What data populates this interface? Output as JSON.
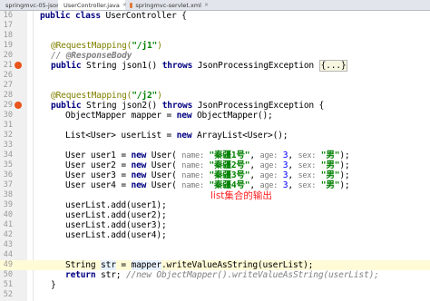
{
  "tabs": [
    {
      "label": "springmvc-05-json",
      "active": false
    },
    {
      "label": "UserController.java",
      "active": true
    },
    {
      "label": "springmvc-servlet.xml",
      "active": false
    }
  ],
  "lines": [
    {
      "n": "16",
      "code": "public class UserController {"
    },
    {
      "n": "17",
      "code": ""
    },
    {
      "n": "18",
      "code": ""
    },
    {
      "n": "19",
      "code": "@RequestMapping(\"/j1\")"
    },
    {
      "n": "20",
      "code": "// @ResponseBody"
    },
    {
      "n": "21",
      "code": "public String json1() throws JsonProcessingException {...}"
    },
    {
      "n": "26",
      "code": ""
    },
    {
      "n": "27",
      "code": ""
    },
    {
      "n": "28",
      "code": "@RequestMapping(\"/j2\")"
    },
    {
      "n": "29",
      "code": "public String json2() throws JsonProcessingException {"
    },
    {
      "n": "30",
      "code": "ObjectMapper mapper = new ObjectMapper();"
    },
    {
      "n": "31",
      "code": ""
    },
    {
      "n": "32",
      "code": "List<User> userList = new ArrayList<User>();"
    },
    {
      "n": "33",
      "code": ""
    },
    {
      "n": "34",
      "code": "User user1 = new User( name: \"秦疆1号\", age: 3, sex: \"男\");"
    },
    {
      "n": "35",
      "code": "User user2 = new User( name: \"秦疆2号\", age: 3, sex: \"男\");"
    },
    {
      "n": "36",
      "code": "User user3 = new User( name: \"秦疆3号\", age: 3, sex: \"男\");"
    },
    {
      "n": "37",
      "code": "User user4 = new User( name: \"秦疆4号\", age: 3, sex: \"男\");"
    },
    {
      "n": "38",
      "code": ""
    },
    {
      "n": "39",
      "code": "userList.add(user1);"
    },
    {
      "n": "40",
      "code": "userList.add(user2);"
    },
    {
      "n": "41",
      "code": "userList.add(user3);"
    },
    {
      "n": "42",
      "code": "userList.add(user4);"
    },
    {
      "n": "43",
      "code": ""
    },
    {
      "n": "44",
      "code": ""
    },
    {
      "n": "49",
      "code": "String str = mapper.writeValueAsString(userList);"
    },
    {
      "n": "50",
      "code": "return str; //new ObjectMapper().writeValueAsString(userList);"
    },
    {
      "n": "51",
      "code": "}"
    },
    {
      "n": "52",
      "code": ""
    }
  ],
  "overlay_text": "list集合的输出",
  "colors": {
    "keyword": "#000080",
    "annotation": "#808000",
    "string": "#008000",
    "number": "#0000ff",
    "comment": "#808080",
    "overlay": "#ff2020"
  }
}
